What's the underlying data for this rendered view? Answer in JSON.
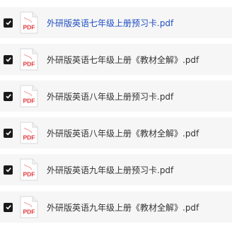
{
  "files": [
    {
      "name": "外研版英语七年级上册预习卡.pdf",
      "checked": true,
      "active": true
    },
    {
      "name": "外研版英语七年级上册《教材全解》.pdf",
      "checked": true,
      "active": false
    },
    {
      "name": "外研版英语八年级上册预习卡.pdf",
      "checked": true,
      "active": false
    },
    {
      "name": "外研版英语八年级上册《教材全解》.pdf",
      "checked": true,
      "active": false
    },
    {
      "name": "外研版英语九年级上册预习卡.pdf",
      "checked": true,
      "active": false
    },
    {
      "name": "外研版英语九年级上册《教材全解》.pdf",
      "checked": true,
      "active": false
    }
  ],
  "icons": {
    "checkbox": "checkbox-checked-icon",
    "file": "pdf-file-icon"
  },
  "icon_label": "PDF",
  "colors": {
    "active_link": "#1f4fc4",
    "text": "#333333",
    "pdf_red": "#e3393c",
    "row_bg": "#f6f6f6"
  }
}
